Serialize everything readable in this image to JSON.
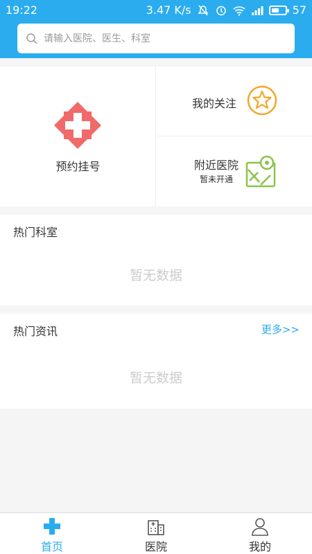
{
  "status_bar": {
    "time": "19:22",
    "network_speed": "3.47 K/s",
    "battery_level": "57"
  },
  "search": {
    "placeholder": "请输入医院、医生、科室"
  },
  "menu": {
    "appointment_label": "预约挂号",
    "follow_label": "我的关注",
    "nearby_label": "附近医院",
    "nearby_sub": "暂未开通"
  },
  "hot_departments": {
    "title": "热门科室",
    "empty_text": "暂无数据"
  },
  "hot_news": {
    "title": "热门资讯",
    "more_label": "更多>>",
    "empty_text": "暂无数据"
  },
  "tabbar": {
    "home_label": "首页",
    "hospital_label": "医院",
    "mine_label": "我的",
    "active": "home"
  },
  "colors": {
    "accent": "#2aacef",
    "appointment_icon": "#f06a6a",
    "star_icon": "#f5a623",
    "map_icon": "#8bc34a"
  }
}
